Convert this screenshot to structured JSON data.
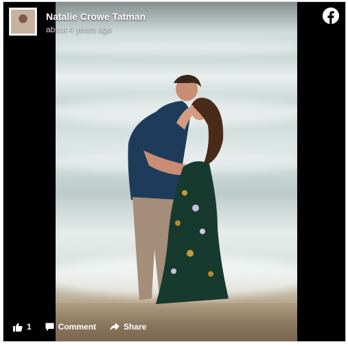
{
  "post": {
    "author_name": "Natalie Crowe Tatman",
    "timestamp": "about 4 years ago",
    "platform_icon": "facebook-icon"
  },
  "actions": {
    "like_count": "1",
    "comment_label": "Comment",
    "share_label": "Share"
  },
  "colors": {
    "background": "#000000",
    "text": "#ffffff",
    "timestamp": "#d8dada"
  }
}
